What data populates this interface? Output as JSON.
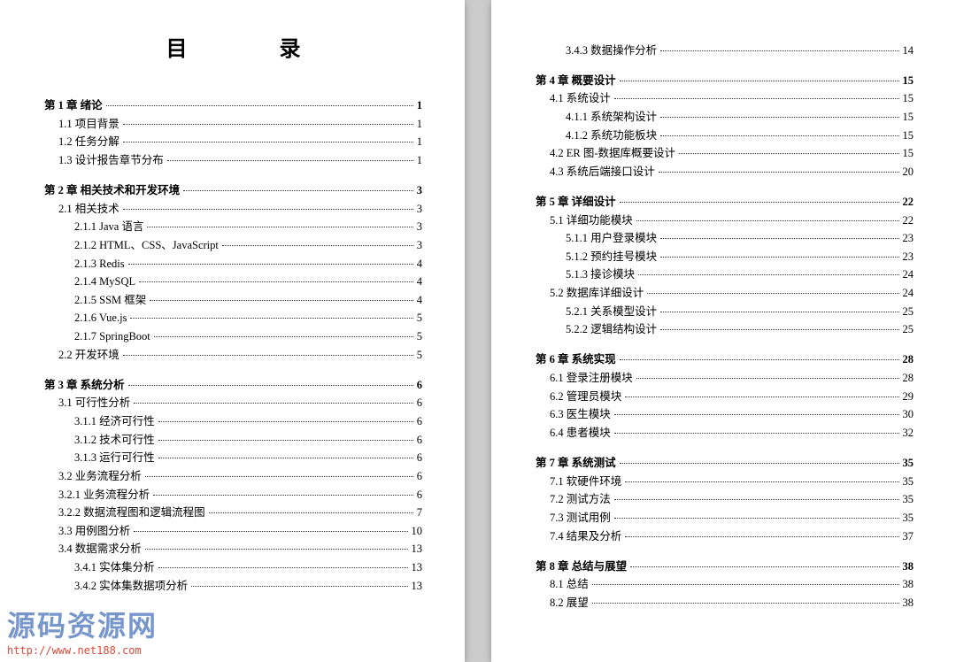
{
  "title": "目　录",
  "watermark": {
    "text": "源码资源网",
    "url": "http://www.net188.com"
  },
  "left": [
    {
      "level": 0,
      "kind": "chapter",
      "label": "第 1 章 绪论",
      "page": "1"
    },
    {
      "level": 1,
      "kind": "section",
      "label": "1.1 项目背景",
      "page": "1"
    },
    {
      "level": 1,
      "kind": "section",
      "label": "1.2 任务分解",
      "page": "1"
    },
    {
      "level": 1,
      "kind": "section",
      "label": "1.3 设计报告章节分布",
      "page": "1"
    },
    {
      "level": 0,
      "kind": "chapter",
      "label": "第 2 章 相关技术和开发环境",
      "page": "3"
    },
    {
      "level": 1,
      "kind": "section",
      "label": "2.1 相关技术",
      "page": "3"
    },
    {
      "level": 2,
      "kind": "sub",
      "label": "2.1.1 Java 语言",
      "page": "3"
    },
    {
      "level": 2,
      "kind": "sub",
      "label": "2.1.2 HTML、CSS、JavaScript",
      "page": "3"
    },
    {
      "level": 2,
      "kind": "sub",
      "label": "2.1.3 Redis",
      "page": "4"
    },
    {
      "level": 2,
      "kind": "sub",
      "label": "2.1.4 MySQL",
      "page": "4"
    },
    {
      "level": 2,
      "kind": "sub",
      "label": "2.1.5 SSM 框架",
      "page": "4"
    },
    {
      "level": 2,
      "kind": "sub",
      "label": "2.1.6 Vue.js",
      "page": "5"
    },
    {
      "level": 2,
      "kind": "sub",
      "label": "2.1.7 SpringBoot",
      "page": "5"
    },
    {
      "level": 1,
      "kind": "section",
      "label": "2.2 开发环境",
      "page": "5"
    },
    {
      "level": 0,
      "kind": "chapter",
      "label": "第 3 章 系统分析",
      "page": "6"
    },
    {
      "level": 1,
      "kind": "section",
      "label": "3.1 可行性分析",
      "page": "6"
    },
    {
      "level": 2,
      "kind": "sub",
      "label": "3.1.1 经济可行性",
      "page": "6"
    },
    {
      "level": 2,
      "kind": "sub",
      "label": "3.1.2 技术可行性",
      "page": "6"
    },
    {
      "level": 2,
      "kind": "sub",
      "label": "3.1.3 运行可行性",
      "page": "6"
    },
    {
      "level": 1,
      "kind": "section",
      "label": "3.2 业务流程分析",
      "page": "6"
    },
    {
      "level": 1,
      "kind": "section",
      "label": "3.2.1 业务流程分析",
      "page": "6"
    },
    {
      "level": 1,
      "kind": "section",
      "label": "3.2.2 数据流程图和逻辑流程图",
      "page": "7"
    },
    {
      "level": 1,
      "kind": "section",
      "label": "3.3 用例图分析",
      "page": "10"
    },
    {
      "level": 1,
      "kind": "section",
      "label": "3.4 数据需求分析",
      "page": "13"
    },
    {
      "level": 2,
      "kind": "sub",
      "label": "3.4.1 实体集分析",
      "page": "13"
    },
    {
      "level": 2,
      "kind": "sub",
      "label": "3.4.2 实体集数据项分析",
      "page": "13"
    }
  ],
  "right": [
    {
      "level": 2,
      "kind": "sub",
      "label": "3.4.3 数据操作分析",
      "page": "14"
    },
    {
      "level": 0,
      "kind": "chapter",
      "label": "第 4 章 概要设计",
      "page": "15"
    },
    {
      "level": 1,
      "kind": "section",
      "label": "4.1 系统设计",
      "page": "15"
    },
    {
      "level": 2,
      "kind": "sub",
      "label": "4.1.1 系统架构设计",
      "page": "15"
    },
    {
      "level": 2,
      "kind": "sub",
      "label": "4.1.2 系统功能板块",
      "page": "15"
    },
    {
      "level": 1,
      "kind": "section",
      "label": "4.2 ER 图-数据库概要设计",
      "page": "15"
    },
    {
      "level": 1,
      "kind": "section",
      "label": "4.3 系统后端接口设计",
      "page": "20"
    },
    {
      "level": 0,
      "kind": "chapter",
      "label": "第 5 章 详细设计",
      "page": "22"
    },
    {
      "level": 1,
      "kind": "section",
      "label": "5.1 详细功能模块",
      "page": "22"
    },
    {
      "level": 2,
      "kind": "sub",
      "label": "5.1.1 用户登录模块",
      "page": "23"
    },
    {
      "level": 2,
      "kind": "sub",
      "label": "5.1.2 预约挂号模块",
      "page": "23"
    },
    {
      "level": 2,
      "kind": "sub",
      "label": "5.1.3 接诊模块",
      "page": "24"
    },
    {
      "level": 1,
      "kind": "section",
      "label": "5.2 数据库详细设计",
      "page": "24"
    },
    {
      "level": 2,
      "kind": "sub",
      "label": "5.2.1 关系模型设计",
      "page": "25"
    },
    {
      "level": 2,
      "kind": "sub",
      "label": "5.2.2 逻辑结构设计",
      "page": "25"
    },
    {
      "level": 0,
      "kind": "chapter",
      "label": "第 6 章 系统实现",
      "page": "28"
    },
    {
      "level": 1,
      "kind": "section",
      "label": "6.1 登录注册模块",
      "page": "28"
    },
    {
      "level": 1,
      "kind": "section",
      "label": "6.2 管理员模块",
      "page": "29"
    },
    {
      "level": 1,
      "kind": "section",
      "label": "6.3 医生模块",
      "page": "30"
    },
    {
      "level": 1,
      "kind": "section",
      "label": "6.4 患者模块",
      "page": "32"
    },
    {
      "level": 0,
      "kind": "chapter",
      "label": "第 7 章 系统测试",
      "page": "35"
    },
    {
      "level": 1,
      "kind": "section",
      "label": "7.1 软硬件环境",
      "page": "35"
    },
    {
      "level": 1,
      "kind": "section",
      "label": "7.2 测试方法",
      "page": "35"
    },
    {
      "level": 1,
      "kind": "section",
      "label": "7.3 测试用例",
      "page": "35"
    },
    {
      "level": 1,
      "kind": "section",
      "label": "7.4 结果及分析",
      "page": "37"
    },
    {
      "level": 0,
      "kind": "chapter",
      "label": "第 8 章 总结与展望",
      "page": "38"
    },
    {
      "level": 1,
      "kind": "section",
      "label": "8.1 总结",
      "page": "38"
    },
    {
      "level": 1,
      "kind": "section",
      "label": "8.2 展望",
      "page": "38"
    }
  ]
}
